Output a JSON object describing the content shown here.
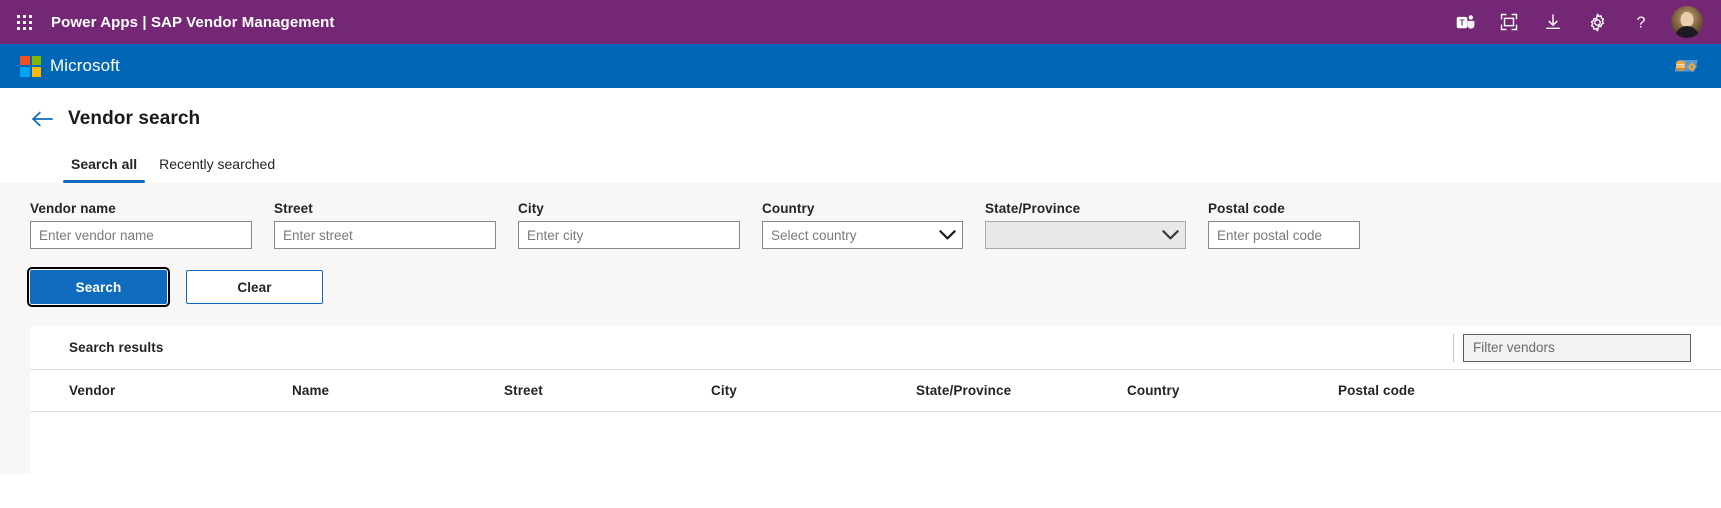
{
  "suite_bar": {
    "waffle_icon": "app-launcher-waffle-icon",
    "app_name": "Power Apps",
    "separator": "|",
    "environment_name": "SAP Vendor Management",
    "title": "Power Apps  |  SAP Vendor Management",
    "background_color": "#742774",
    "actions": [
      {
        "name": "teams-icon",
        "label": "Teams"
      },
      {
        "name": "fit-to-screen-icon",
        "label": "Fit to screen"
      },
      {
        "name": "download-icon",
        "label": "Download"
      },
      {
        "name": "gear-icon",
        "label": "Settings"
      },
      {
        "name": "help-question-icon",
        "label": "Help"
      }
    ],
    "avatar": {
      "name": "user-avatar",
      "label": "Account manager"
    }
  },
  "brand_bar": {
    "logo_text": "Microsoft",
    "background_color": "#0067b8",
    "right_icon": "data-source-settings-icon"
  },
  "page": {
    "back_label": "Back",
    "title": "Vendor search",
    "tabs": [
      {
        "label": "Search all",
        "active": true
      },
      {
        "label": "Recently searched",
        "active": false
      }
    ]
  },
  "search_form": {
    "background_color": "#f8f7f6",
    "fields": [
      {
        "label": "Vendor name",
        "placeholder": "Enter vendor name",
        "value": "",
        "type": "text",
        "disabled": false
      },
      {
        "label": "Street",
        "placeholder": "Enter street",
        "value": "",
        "type": "text",
        "disabled": false
      },
      {
        "label": "City",
        "placeholder": "Enter city",
        "value": "",
        "type": "text",
        "disabled": false
      },
      {
        "label": "Country",
        "placeholder": "Select country",
        "value": "",
        "type": "select",
        "disabled": false
      },
      {
        "label": "State/Province",
        "placeholder": "",
        "value": "",
        "type": "select",
        "disabled": true
      },
      {
        "label": "Postal code",
        "placeholder": "Enter postal code",
        "value": "",
        "type": "text",
        "disabled": false
      }
    ],
    "buttons": {
      "search_label": "Search",
      "clear_label": "Clear",
      "primary_color": "#0f6cbd",
      "search_focused": true
    }
  },
  "results": {
    "title": "Search results",
    "filter": {
      "placeholder": "Filter vendors",
      "value": ""
    },
    "columns": [
      "Vendor",
      "Name",
      "Street",
      "City",
      "State/Province",
      "Country",
      "Postal code"
    ],
    "rows": [],
    "row_count": 0
  }
}
